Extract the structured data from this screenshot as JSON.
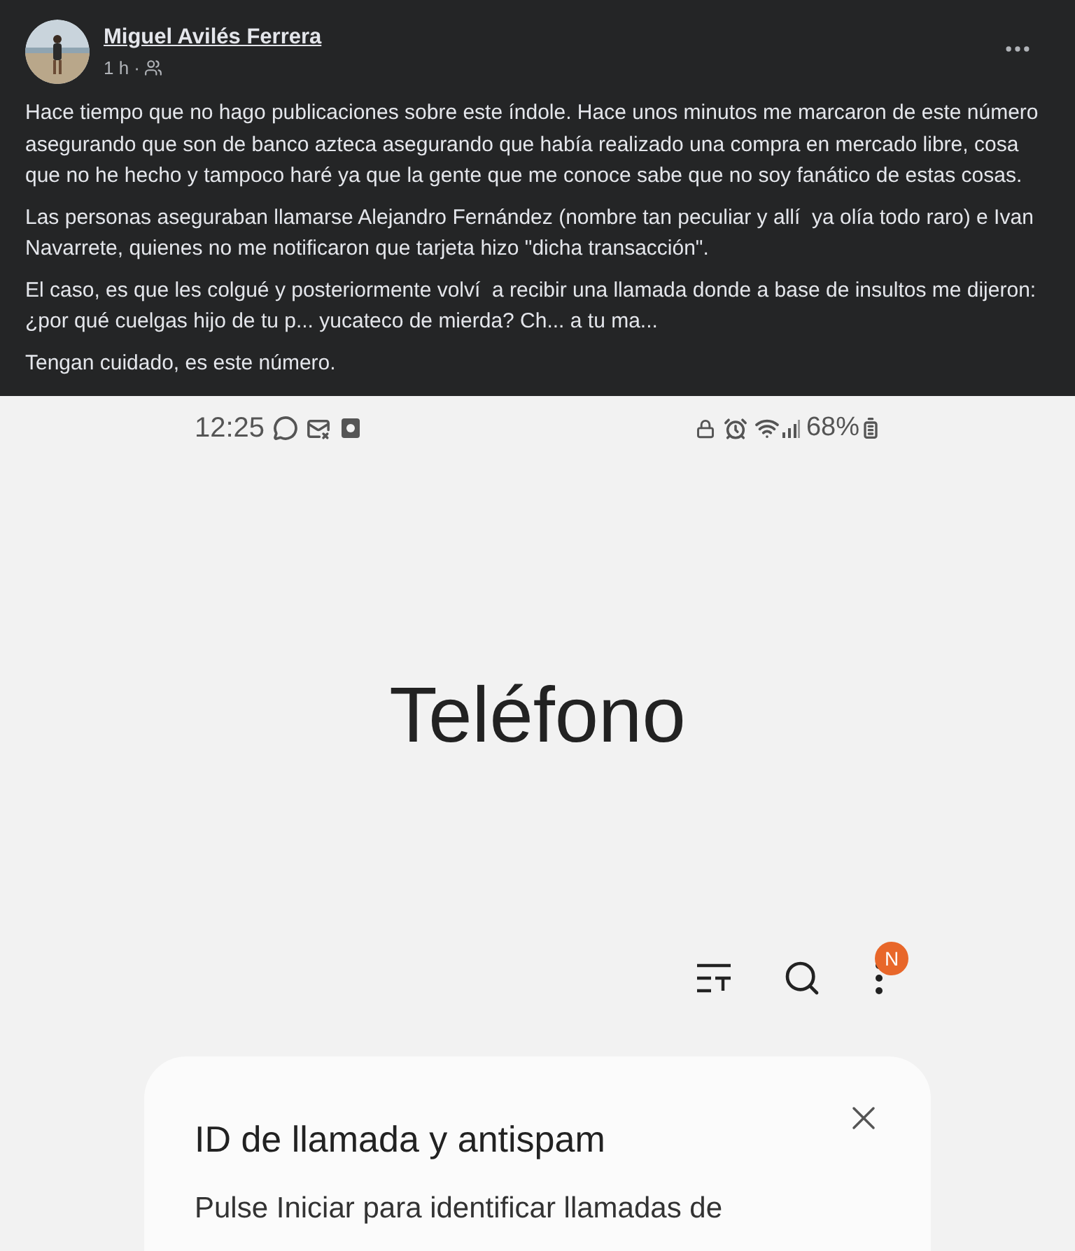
{
  "post": {
    "author": "Miguel Avilés Ferrera",
    "time": "1 h ·",
    "paragraphs": [
      "Hace tiempo que no hago publicaciones sobre este índole. Hace unos minutos me marcaron de este número asegurando que son de banco azteca asegurando que había realizado una compra en mercado libre, cosa que no he hecho y tampoco haré ya que la gente que me conoce sabe que no soy fanático de estas cosas.",
      "Las personas aseguraban llamarse Alejandro Fernández (nombre tan peculiar y allí  ya olía todo raro) e Ivan Navarrete, quienes no me notificaron que tarjeta hizo \"dicha transacción\".",
      "El caso, es que les colgué y posteriormente volví  a recibir una llamada donde a base de insultos me dijeron: ¿por qué cuelgas hijo de tu p... yucateco de mierda? Ch... a tu ma...",
      "Tengan cuidado, es este número."
    ]
  },
  "phone": {
    "status_bar": {
      "time": "12:25",
      "battery": "68%"
    },
    "app_title": "Teléfono",
    "toolbar": {
      "badge": "N"
    },
    "card": {
      "title": "ID de llamada y antispam",
      "text": "Pulse Iniciar para identificar llamadas de"
    }
  }
}
